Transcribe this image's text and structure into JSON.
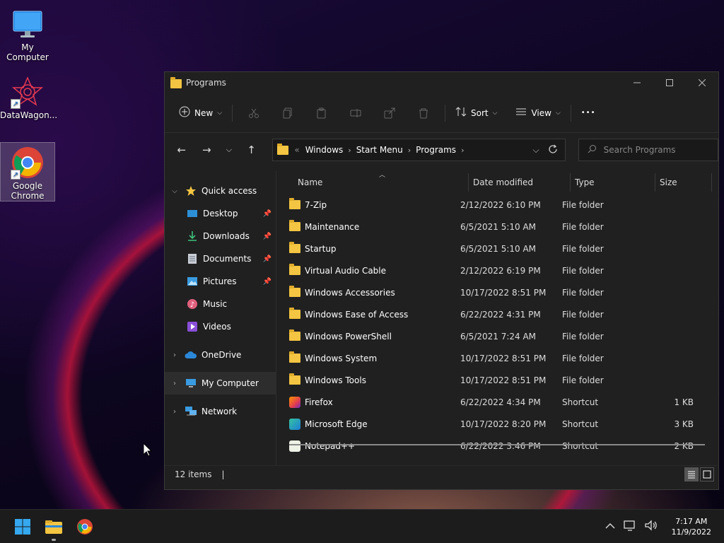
{
  "desktop": {
    "icons": [
      {
        "label": "My Computer"
      },
      {
        "label": "DataWagon..."
      },
      {
        "label": "Google Chrome"
      }
    ]
  },
  "window": {
    "title": "Programs",
    "toolbar": {
      "new_label": "New",
      "sort_label": "Sort",
      "view_label": "View",
      "more_label": "•••"
    },
    "address": {
      "crumbs": [
        "Windows",
        "Start Menu",
        "Programs"
      ],
      "overflow": "«"
    },
    "search": {
      "placeholder": "Search Programs"
    },
    "nav": {
      "quick_access": "Quick access",
      "desktop": "Desktop",
      "downloads": "Downloads",
      "documents": "Documents",
      "pictures": "Pictures",
      "music": "Music",
      "videos": "Videos",
      "onedrive": "OneDrive",
      "my_computer": "My Computer",
      "network": "Network"
    },
    "columns": {
      "name": "Name",
      "date": "Date modified",
      "type": "Type",
      "size": "Size"
    },
    "files": [
      {
        "name": "7-Zip",
        "date": "2/12/2022 6:10 PM",
        "type": "File folder",
        "size": ""
      },
      {
        "name": "Maintenance",
        "date": "6/5/2021 5:10 AM",
        "type": "File folder",
        "size": ""
      },
      {
        "name": "Startup",
        "date": "6/5/2021 5:10 AM",
        "type": "File folder",
        "size": ""
      },
      {
        "name": "Virtual Audio Cable",
        "date": "2/12/2022 6:19 PM",
        "type": "File folder",
        "size": ""
      },
      {
        "name": "Windows Accessories",
        "date": "10/17/2022 8:51 PM",
        "type": "File folder",
        "size": ""
      },
      {
        "name": "Windows Ease of Access",
        "date": "6/22/2022 4:31 PM",
        "type": "File folder",
        "size": ""
      },
      {
        "name": "Windows PowerShell",
        "date": "6/5/2021 7:24 AM",
        "type": "File folder",
        "size": ""
      },
      {
        "name": "Windows System",
        "date": "10/17/2022 8:51 PM",
        "type": "File folder",
        "size": ""
      },
      {
        "name": "Windows Tools",
        "date": "10/17/2022 8:51 PM",
        "type": "File folder",
        "size": ""
      },
      {
        "name": "Firefox",
        "date": "6/22/2022 4:34 PM",
        "type": "Shortcut",
        "size": "1 KB"
      },
      {
        "name": "Microsoft Edge",
        "date": "10/17/2022 8:20 PM",
        "type": "Shortcut",
        "size": "3 KB"
      },
      {
        "name": "Notepad++",
        "date": "6/22/2022 3:46 PM",
        "type": "Shortcut",
        "size": "2 KB"
      }
    ],
    "status": {
      "count": "12 items"
    }
  },
  "taskbar": {
    "time": "7:17 AM",
    "date": "11/9/2022"
  },
  "colors": {
    "window_bg": "#202020",
    "folder": "#f4c542",
    "accent": "#0078d4"
  }
}
